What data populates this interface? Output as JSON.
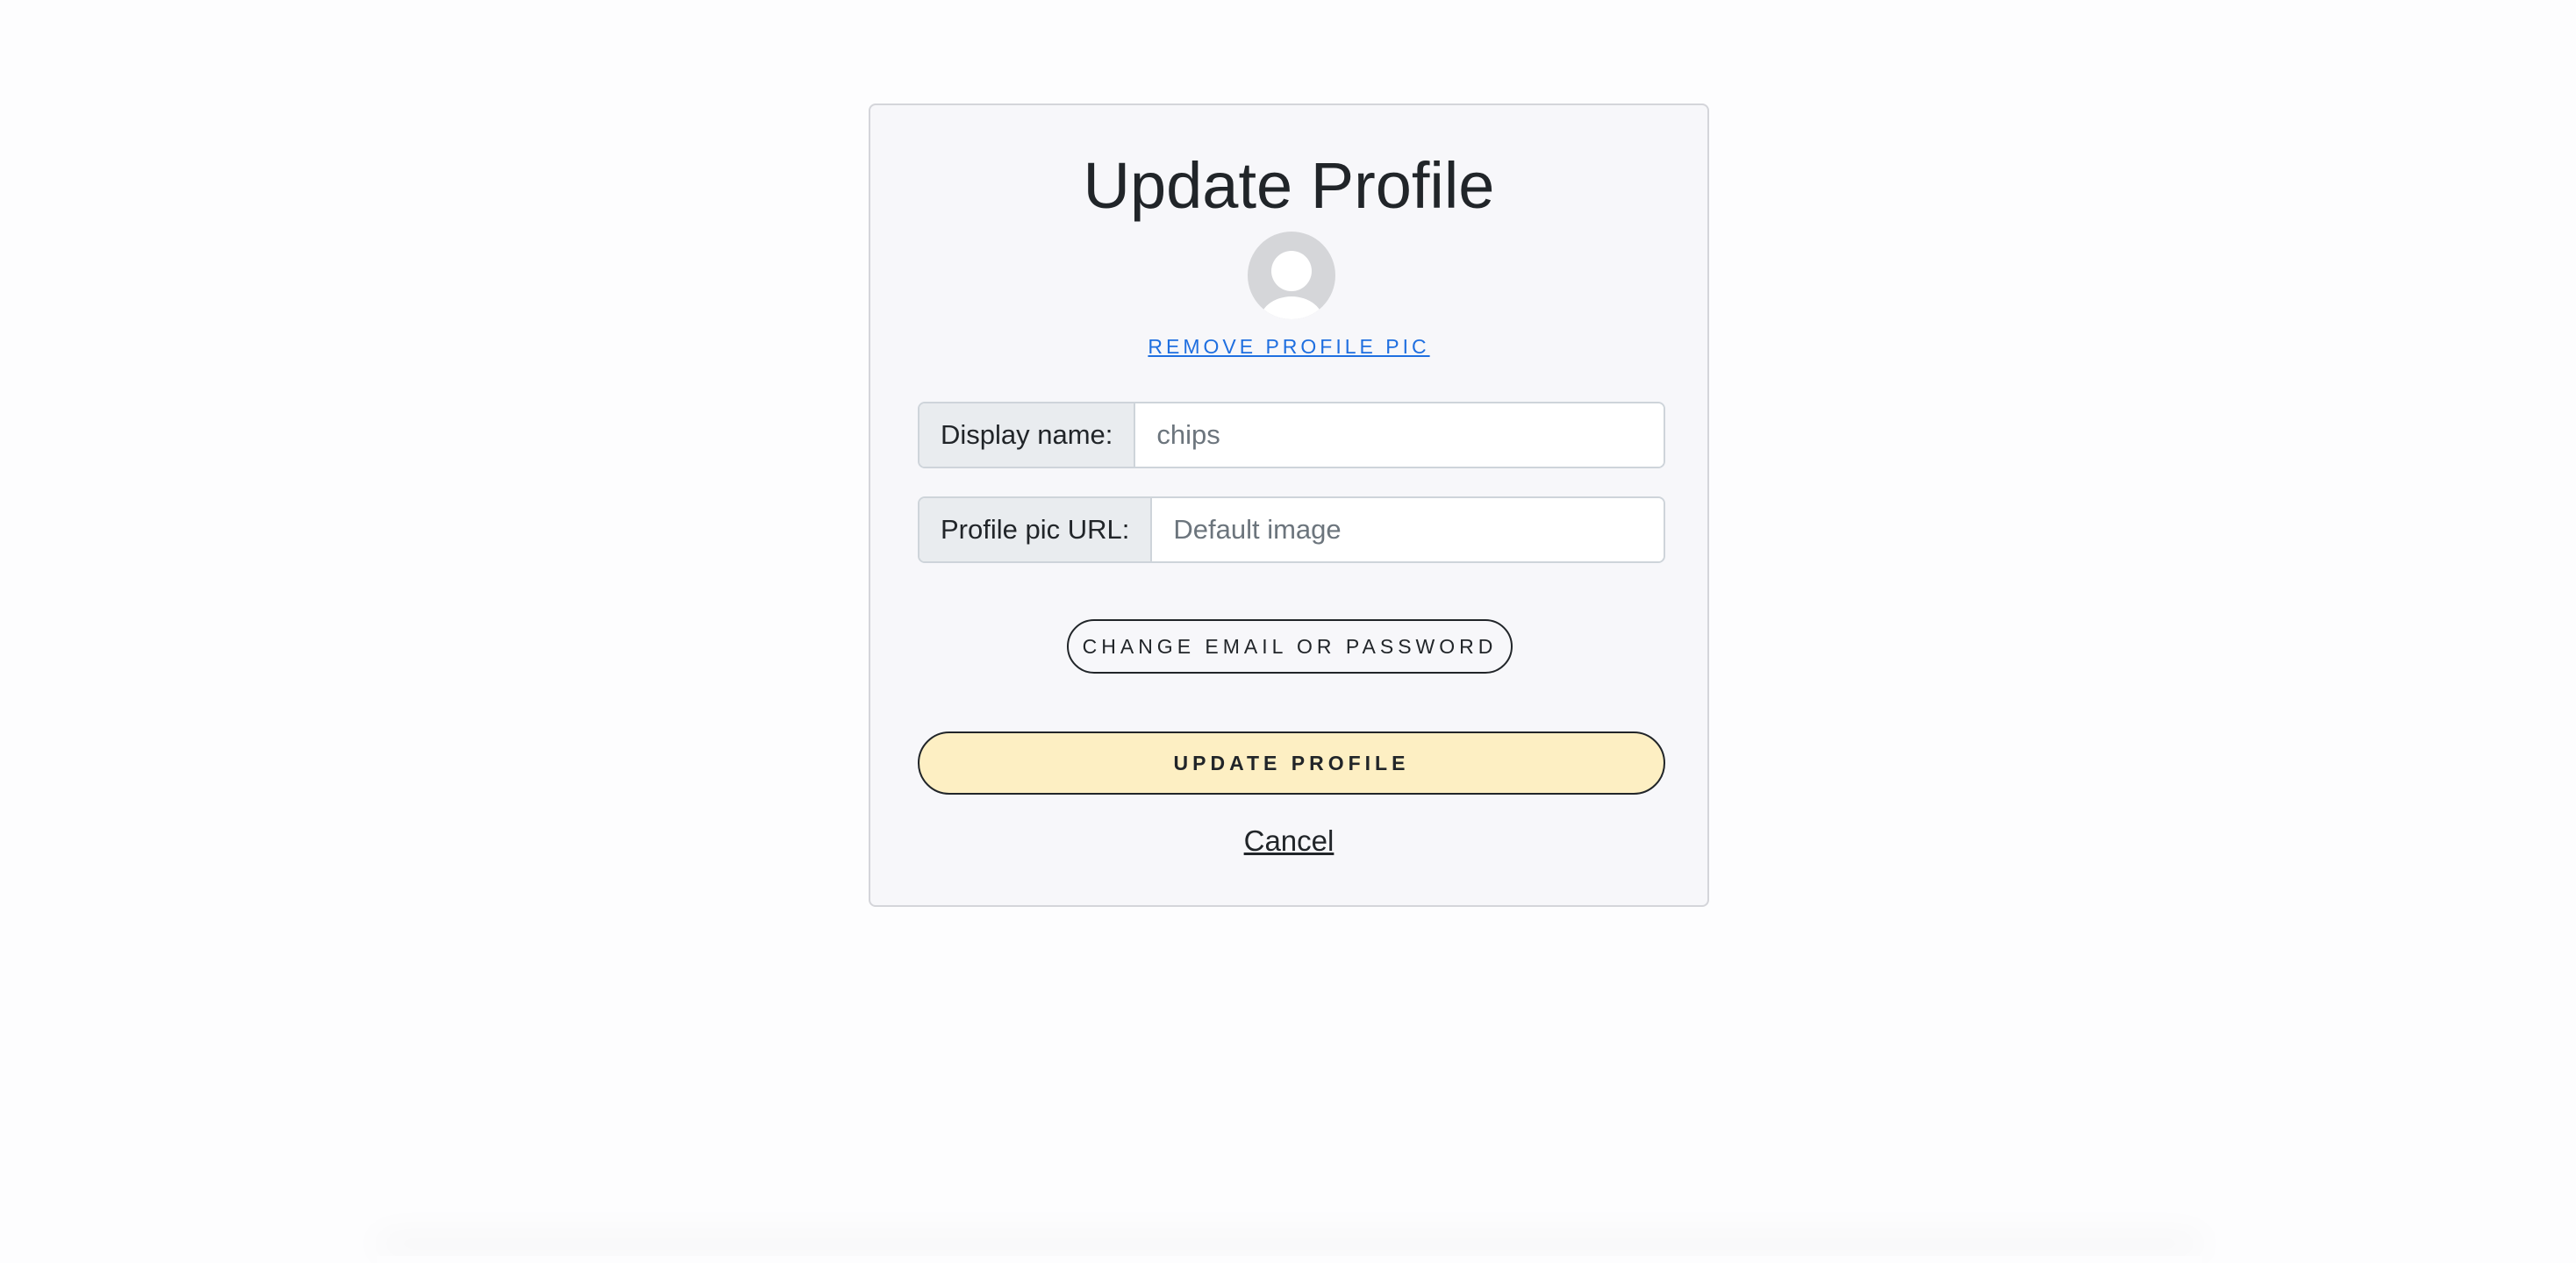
{
  "card": {
    "title": "Update Profile",
    "remove_pic_label": "REMOVE PROFILE PIC"
  },
  "form": {
    "display_name": {
      "label": "Display name:",
      "placeholder": "chips",
      "value": ""
    },
    "profile_pic_url": {
      "label": "Profile pic URL:",
      "placeholder": "Default image",
      "value": ""
    }
  },
  "actions": {
    "change_credentials_label": "CHANGE EMAIL OR PASSWORD",
    "update_label": "UPDATE PROFILE",
    "cancel_label": "Cancel"
  },
  "icons": {
    "avatar": "user-avatar-icon"
  },
  "colors": {
    "page_background": "#fdfdfe",
    "card_background": "#f7f7fa",
    "link_blue": "#1f6fe0",
    "primary_button": "#fdefc3",
    "text": "#212529"
  }
}
